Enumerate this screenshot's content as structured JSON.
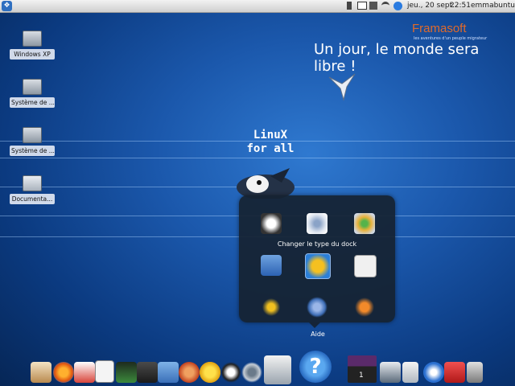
{
  "panel": {
    "menu_glyph": "❖",
    "date": "jeu., 20 sept.",
    "time": "22:51",
    "user": "emmabuntus",
    "tray_icons": [
      "phone-icon",
      "mail-icon",
      "volume-icon",
      "wifi-icon",
      "info-icon"
    ]
  },
  "desktop_icons": [
    {
      "label": "Windows XP",
      "icon": "hard-drive-icon"
    },
    {
      "label": "Système de ...",
      "icon": "hard-drive-icon"
    },
    {
      "label": "Système de ...",
      "icon": "hard-drive-icon"
    },
    {
      "label": "Documenta...",
      "icon": "folder-icon"
    }
  ],
  "wallpaper": {
    "brand": "Framasoft",
    "brand_tagline": "les aventures d'un peuple migrateur",
    "slogan": "Un jour, le monde sera libre !",
    "linux_line1": "LinuX",
    "linux_line2": "for all"
  },
  "dock_popup": {
    "title": "Changer le type du dock",
    "icons": [
      "tux-dock-icon",
      "gear-wheel-icon",
      "color-wheel-icon",
      "text-editor-icon",
      "yellow-launcher-icon",
      "accessibility-icon",
      "xfce-small-icon",
      "ubuntu-mouse-icon",
      "ubuntu-orange-icon"
    ],
    "selected_icon": "yellow-launcher-icon"
  },
  "dock_tooltip": "Aide",
  "dock": {
    "icons": [
      "home-icon",
      "firefox-icon",
      "mail-client-icon",
      "document-icon",
      "mixer-icon",
      "video-icon",
      "photo-icon",
      "media-player-icon",
      "star-icon",
      "tux-icon",
      "settings-icon",
      "home-house-icon",
      "help-icon",
      "workspace-switcher-icon",
      "screen-icon",
      "files-icon",
      "xfce-icon",
      "power-icon",
      "trash-icon"
    ],
    "workspace_number": "1"
  }
}
